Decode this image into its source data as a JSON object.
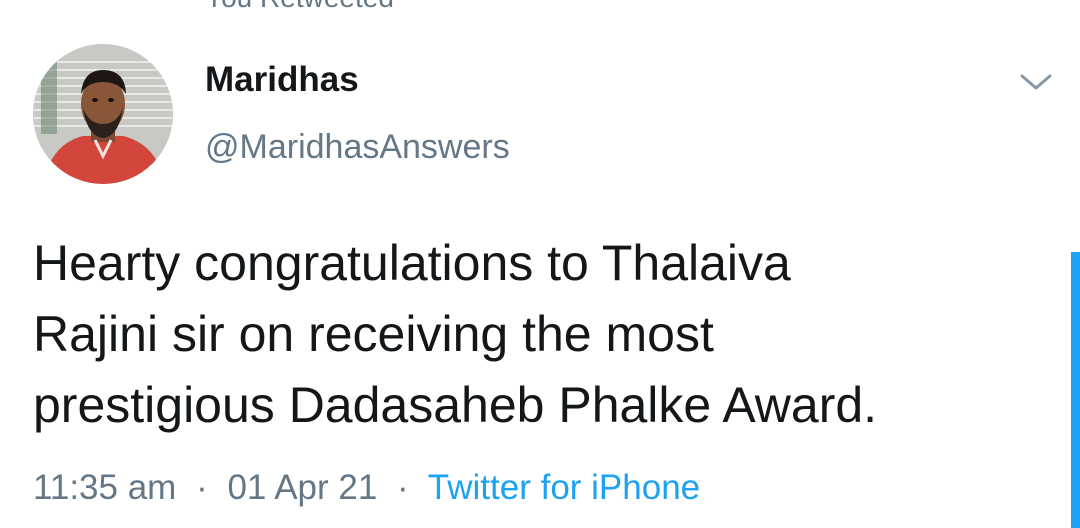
{
  "retweet_header": "You Retweeted",
  "tweet": {
    "author": {
      "display_name": "Maridhas",
      "handle": "@MaridhasAnswers"
    },
    "text": "Hearty congratulations to Thalaiva\nRajini sir on receiving the most\nprestigious Dadasaheb Phalke Award.",
    "time": "11:35 am",
    "date": "01 Apr 21",
    "source": "Twitter for iPhone",
    "separator": "·"
  },
  "icons": {
    "menu": "chevron-down-icon",
    "avatar": "avatar-photo"
  },
  "colors": {
    "text_primary": "#14171a",
    "text_secondary": "#657786",
    "accent": "#1da1f2",
    "background": "#ffffff"
  }
}
